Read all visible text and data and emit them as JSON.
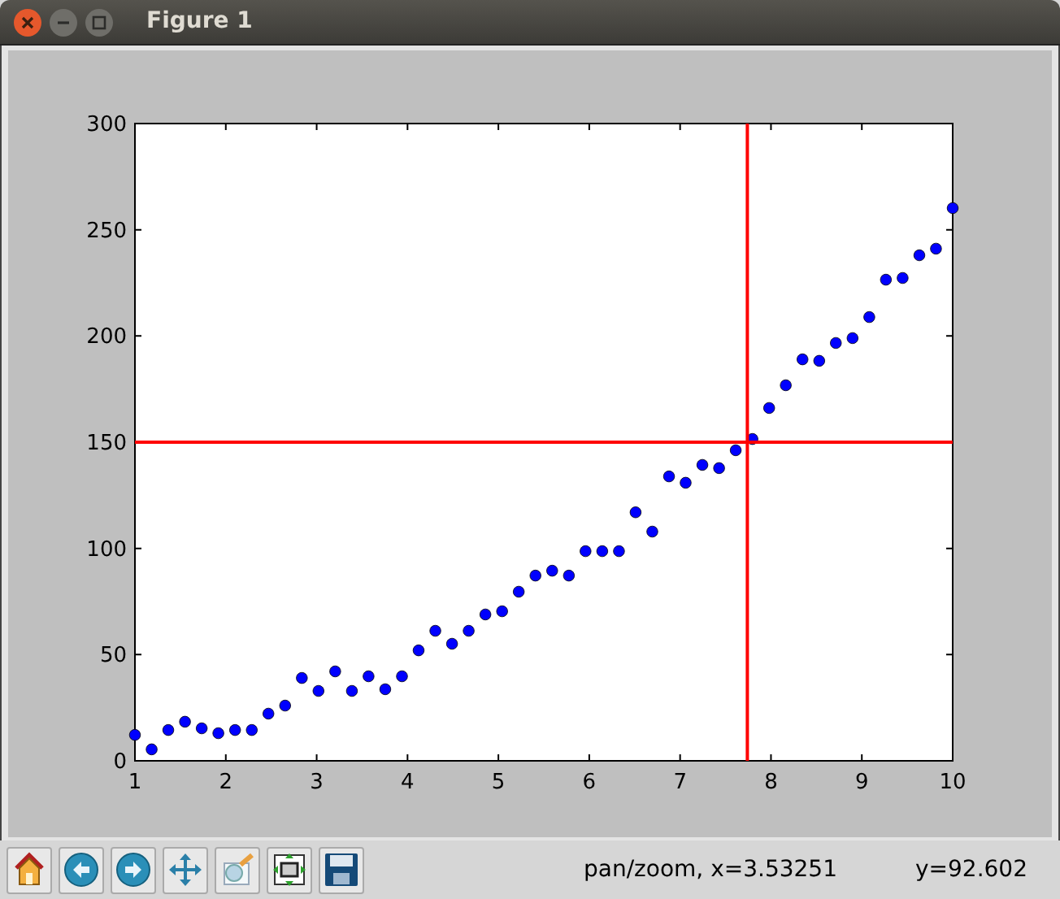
{
  "window": {
    "title": "Figure 1"
  },
  "figure": {
    "chart_data": {
      "type": "scatter",
      "xlim": [
        1,
        10
      ],
      "ylim": [
        0,
        300
      ],
      "xticks": [
        1,
        2,
        3,
        4,
        5,
        6,
        7,
        8,
        9,
        10
      ],
      "yticks": [
        0,
        50,
        100,
        150,
        200,
        250,
        300
      ],
      "x": [
        1,
        1.184,
        1.367,
        1.551,
        1.735,
        1.918,
        2.102,
        2.286,
        2.469,
        2.653,
        2.837,
        3.02,
        3.204,
        3.388,
        3.571,
        3.755,
        3.939,
        4.122,
        4.306,
        4.49,
        4.673,
        4.857,
        5.041,
        5.224,
        5.408,
        5.592,
        5.776,
        5.959,
        6.143,
        6.327,
        6.51,
        6.694,
        6.878,
        7.061,
        7.245,
        7.429,
        7.612,
        7.796,
        7.98,
        8.163,
        8.347,
        8.531,
        8.714,
        8.898,
        9.082,
        9.265,
        9.449,
        9.633,
        9.816,
        10
      ],
      "series": [
        {
          "color": "#0000ff",
          "values": [
            12.2,
            5.4,
            14.5,
            18.4,
            15.3,
            13,
            14.5,
            14.5,
            22.2,
            26,
            39,
            32.9,
            42.1,
            32.9,
            39.8,
            33.7,
            39.8,
            52,
            61.2,
            55.1,
            61.2,
            68.9,
            70.4,
            79.6,
            87.2,
            89.5,
            87.2,
            98.7,
            98.7,
            98.7,
            117,
            107.9,
            133.9,
            130.9,
            139.3,
            137.8,
            146.2,
            151.5,
            166.1,
            176.8,
            189,
            188.3,
            196.7,
            199,
            208.9,
            226.5,
            227.3,
            238,
            241.1,
            260.2
          ]
        }
      ],
      "ref_lines": [
        {
          "axis": "y",
          "value": 150,
          "color": "#ff0000"
        },
        {
          "axis": "x",
          "value": 7.74,
          "color": "#ff0000"
        }
      ]
    }
  },
  "status_bar": {
    "message": "pan/zoom, x=3.53251",
    "y_reading": "y=92.602"
  }
}
